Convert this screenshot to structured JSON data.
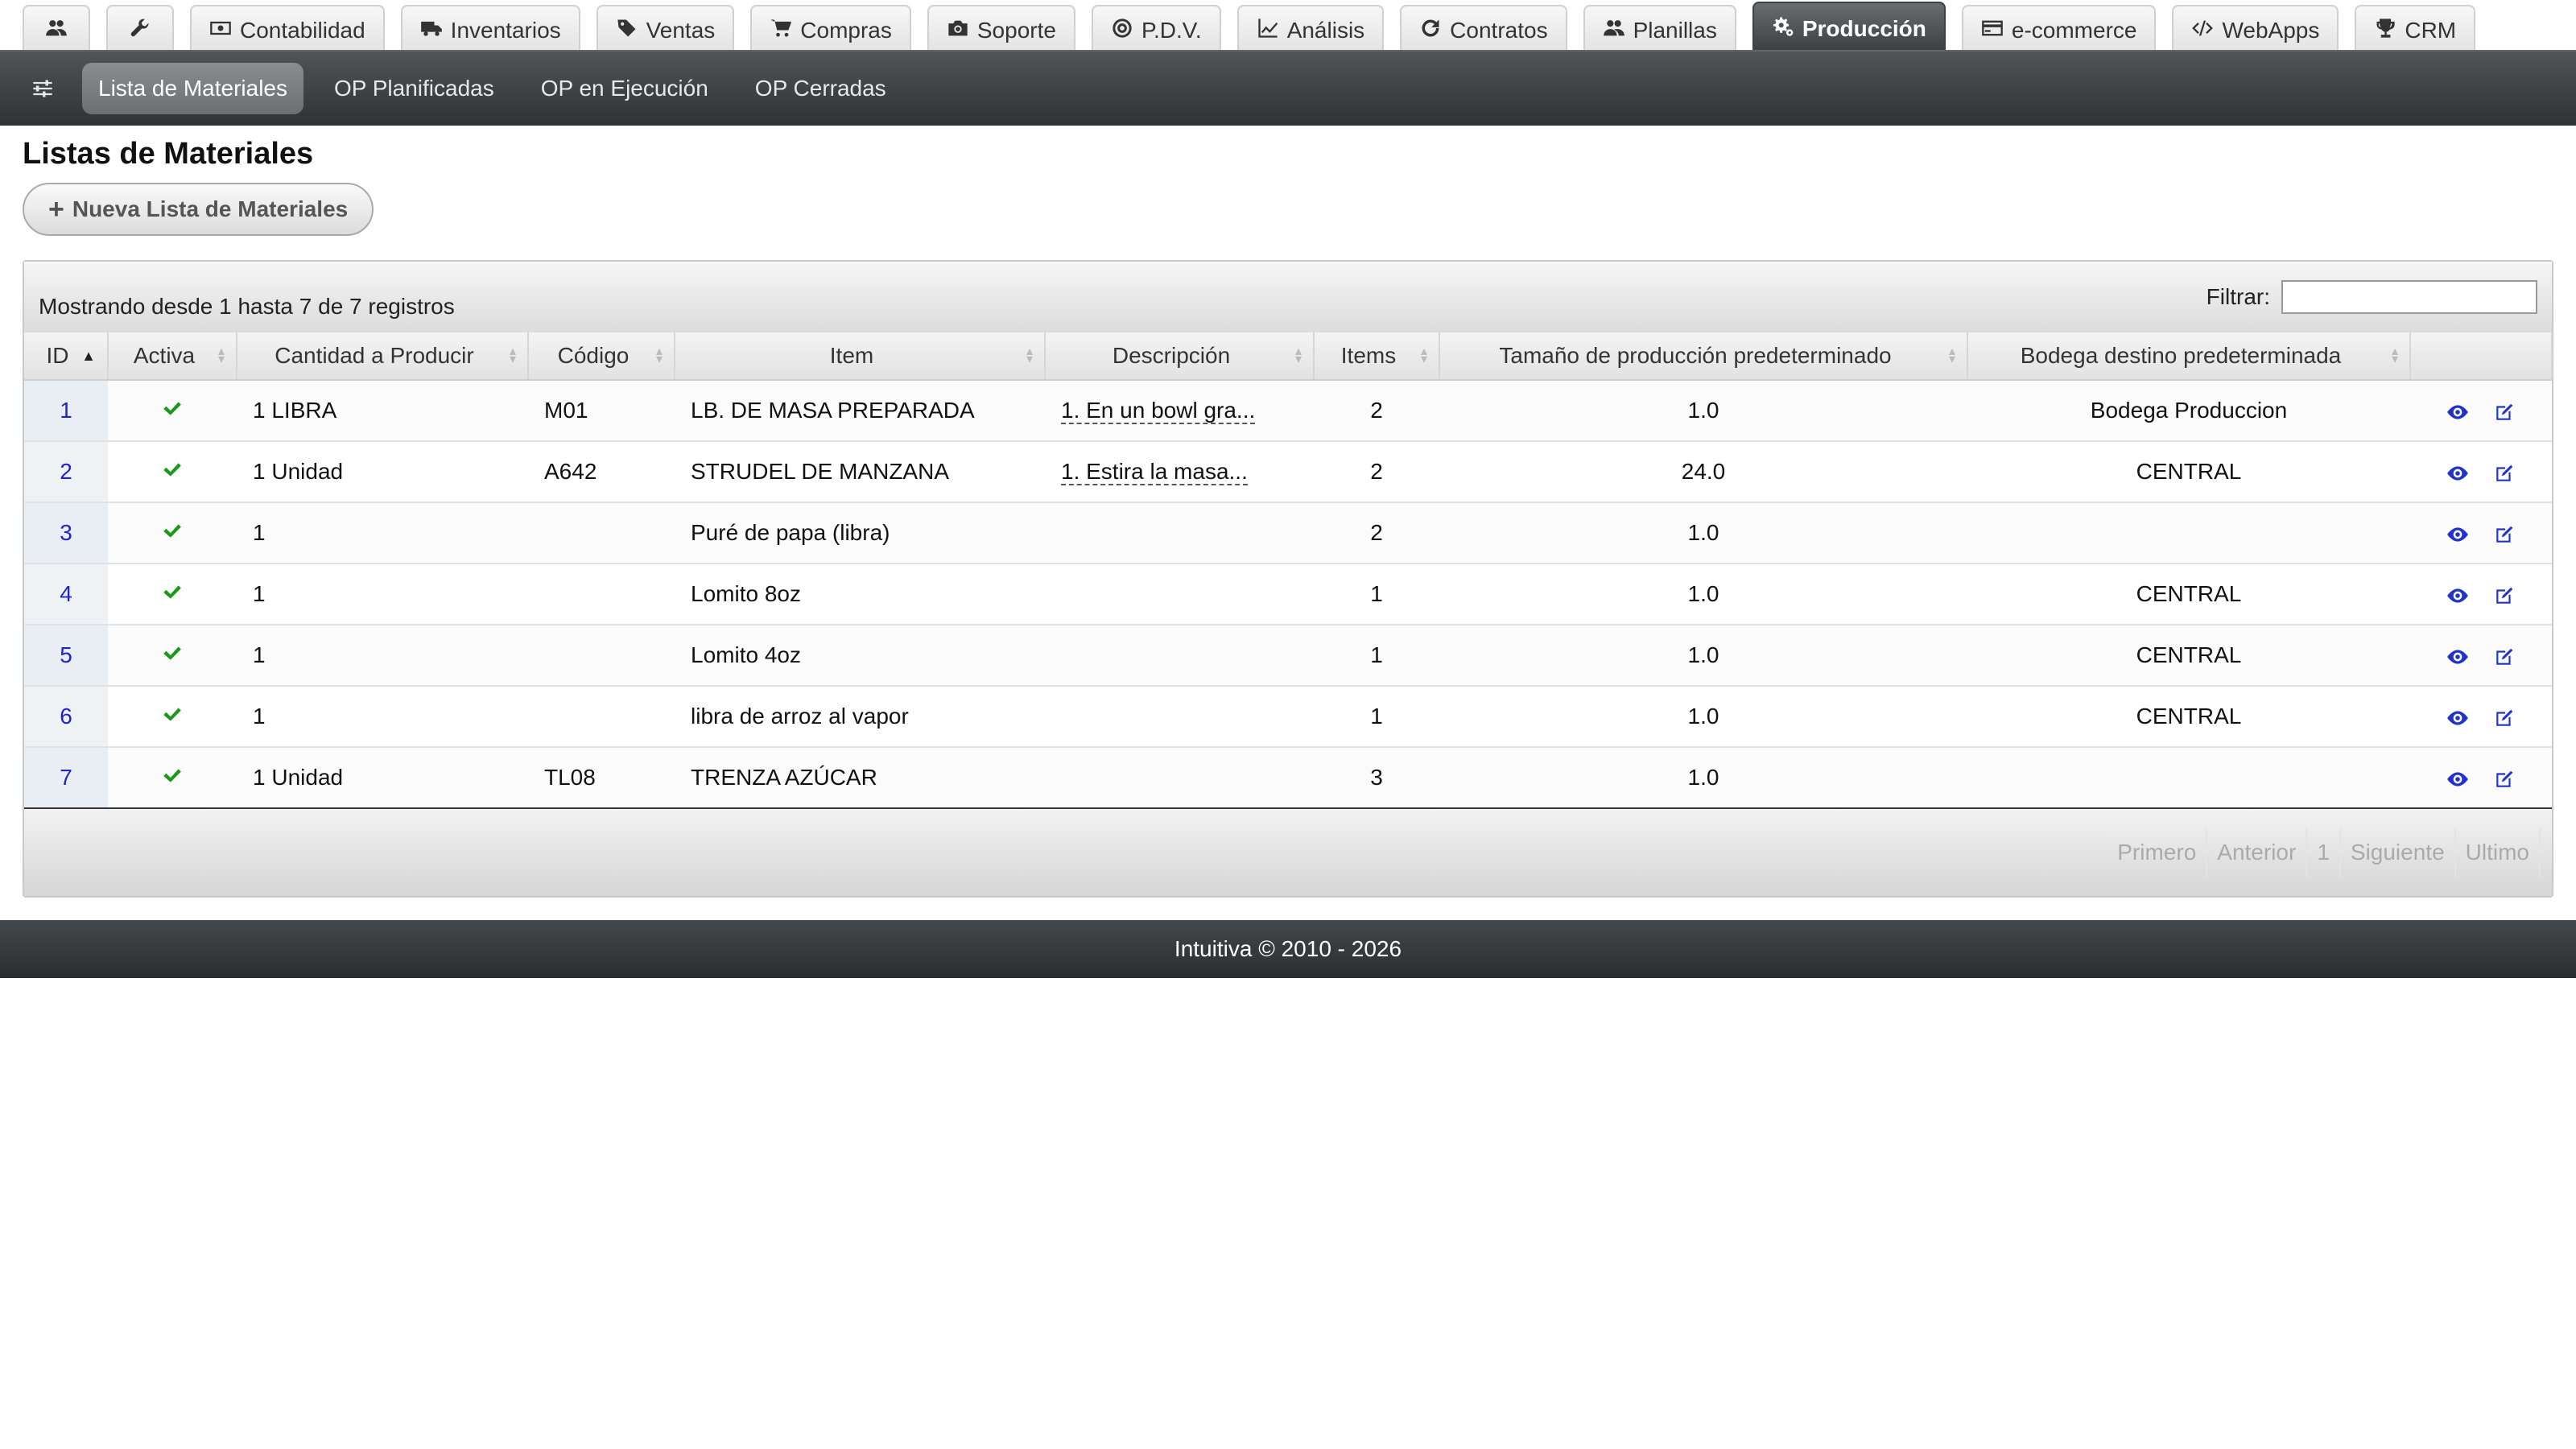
{
  "top_tabs": [
    {
      "label": "",
      "icon": "users-icon"
    },
    {
      "label": "",
      "icon": "wrench-icon"
    },
    {
      "label": "Contabilidad",
      "icon": "money-icon"
    },
    {
      "label": "Inventarios",
      "icon": "truck-icon"
    },
    {
      "label": "Ventas",
      "icon": "tags-icon"
    },
    {
      "label": "Compras",
      "icon": "cart-icon"
    },
    {
      "label": "Soporte",
      "icon": "camera-icon"
    },
    {
      "label": "P.D.V.",
      "icon": "bullseye-icon"
    },
    {
      "label": "Análisis",
      "icon": "line-chart-icon"
    },
    {
      "label": "Contratos",
      "icon": "refresh-icon"
    },
    {
      "label": "Planillas",
      "icon": "users-icon"
    },
    {
      "label": "Producción",
      "icon": "gears-icon",
      "active": true
    },
    {
      "label": "e-commerce",
      "icon": "credit-card-icon"
    },
    {
      "label": "WebApps",
      "icon": "code-icon"
    },
    {
      "label": "CRM",
      "icon": "trophy-icon"
    }
  ],
  "subnav": {
    "items": [
      {
        "label": "Lista de Materiales",
        "active": true
      },
      {
        "label": "OP Planificadas"
      },
      {
        "label": "OP en Ejecución"
      },
      {
        "label": "OP Cerradas"
      }
    ]
  },
  "page": {
    "title": "Listas de Materiales",
    "new_button": "Nueva Lista de Materiales"
  },
  "table": {
    "records_info": "Mostrando desde 1 hasta 7 de 7 registros",
    "filter_label": "Filtrar:",
    "filter_value": "",
    "columns": [
      "ID",
      "Activa",
      "Cantidad a Producir",
      "Código",
      "Item",
      "Descripción",
      "Items",
      "Tamaño de producción predeterminado",
      "Bodega destino predeterminada",
      ""
    ],
    "rows": [
      {
        "id": "1",
        "cantidad": "1 LIBRA",
        "codigo": "M01",
        "item": "LB. DE MASA PREPARADA",
        "descripcion": "1. En un bowl gra...",
        "items": "2",
        "tamano": "1.0",
        "bodega": "Bodega Produccion"
      },
      {
        "id": "2",
        "cantidad": "1 Unidad",
        "codigo": "A642",
        "item": "STRUDEL DE MANZANA",
        "descripcion": "1. Estira la masa...",
        "items": "2",
        "tamano": "24.0",
        "bodega": "CENTRAL"
      },
      {
        "id": "3",
        "cantidad": "1",
        "codigo": "",
        "item": "Puré de papa (libra)",
        "descripcion": "",
        "items": "2",
        "tamano": "1.0",
        "bodega": ""
      },
      {
        "id": "4",
        "cantidad": "1",
        "codigo": "",
        "item": "Lomito 8oz",
        "descripcion": "",
        "items": "1",
        "tamano": "1.0",
        "bodega": "CENTRAL"
      },
      {
        "id": "5",
        "cantidad": "1",
        "codigo": "",
        "item": "Lomito 4oz",
        "descripcion": "",
        "items": "1",
        "tamano": "1.0",
        "bodega": "CENTRAL"
      },
      {
        "id": "6",
        "cantidad": "1",
        "codigo": "",
        "item": "libra de arroz al vapor",
        "descripcion": "",
        "items": "1",
        "tamano": "1.0",
        "bodega": "CENTRAL"
      },
      {
        "id": "7",
        "cantidad": "1 Unidad",
        "codigo": "TL08",
        "item": "TRENZA AZÚCAR",
        "descripcion": "",
        "items": "3",
        "tamano": "1.0",
        "bodega": ""
      }
    ],
    "pager": [
      "Primero",
      "Anterior",
      "1",
      "Siguiente",
      "Ultimo"
    ]
  },
  "footer": {
    "text": "Intuitiva © 2010 - 2026"
  },
  "colors": {
    "active_tab": "#4a4d50",
    "link": "#2222cc",
    "check": "#1a9a1a"
  }
}
